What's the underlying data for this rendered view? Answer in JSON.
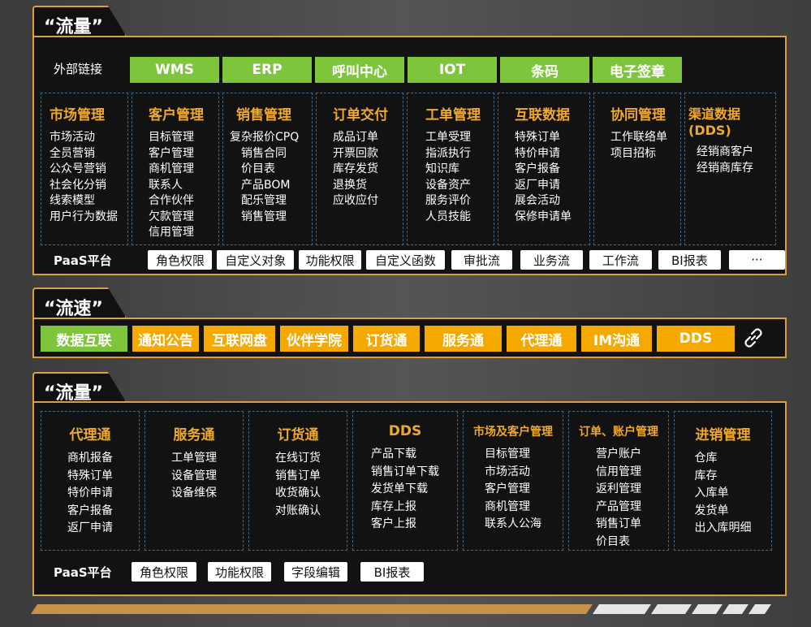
{
  "sections": [
    {
      "title": "“流量”",
      "external_label": "外部链接",
      "external_links": [
        "WMS",
        "ERP",
        "呼叫中心",
        "IOT",
        "条码",
        "电子签章"
      ],
      "modules": [
        {
          "title": "市场管理",
          "items": [
            "市场活动",
            "全员营销",
            "公众号营销",
            "社会化分销",
            "线索模型",
            "用户行为数据"
          ]
        },
        {
          "title": "客户管理",
          "items": [
            "目标管理",
            "客户管理",
            "商机管理",
            "联系人",
            "合作伙伴",
            "欠款管理",
            "信用管理"
          ]
        },
        {
          "title": "销售管理",
          "items": [
            "复杂报价CPQ",
            "销售合同",
            "价目表",
            "产品BOM",
            "配乐管理",
            "销售管理"
          ]
        },
        {
          "title": "订单交付",
          "items": [
            "成品订单",
            "开票回款",
            "库存发货",
            "退换货",
            "应收应付"
          ]
        },
        {
          "title": "工单管理",
          "items": [
            "工单受理",
            "指派执行",
            "知识库",
            "设备资产",
            "服务评价",
            "人员技能"
          ]
        },
        {
          "title": "互联数据",
          "items": [
            "特殊订单",
            "特价申请",
            "客户报备",
            "返厂申请",
            "展会活动",
            "保修申请单"
          ]
        },
        {
          "title": "协同管理",
          "items": [
            "工作联络单",
            "项目招标"
          ]
        },
        {
          "title": "渠道数据(DDS)",
          "items": [
            "经销商客户",
            "经销商库存"
          ]
        }
      ],
      "paas_label": "PaaS平台",
      "paas_items": [
        "角色权限",
        "自定义对象",
        "功能权限",
        "自定义函数",
        "审批流",
        "业务流",
        "工作流",
        "BI报表",
        "···"
      ]
    },
    {
      "title": "“流速”",
      "items": [
        {
          "label": "数据互联",
          "color": "#7ec53b"
        },
        {
          "label": "通知公告",
          "color": "#f5a800"
        },
        {
          "label": "互联网盘",
          "color": "#f5a800"
        },
        {
          "label": "伙伴学院",
          "color": "#f5a800"
        },
        {
          "label": "订货通",
          "color": "#f5a800"
        },
        {
          "label": "服务通",
          "color": "#f5a800"
        },
        {
          "label": "代理通",
          "color": "#f5a800"
        },
        {
          "label": "IM沟通",
          "color": "#f5a800"
        },
        {
          "label": "DDS",
          "color": "#f5a800"
        }
      ],
      "icon": "link-icon"
    },
    {
      "title": "“流量”",
      "modules": [
        {
          "title": "代理通",
          "items": [
            "商机报备",
            "特殊订单",
            "特价申请",
            "客户报备",
            "返厂申请"
          ]
        },
        {
          "title": "服务通",
          "items": [
            "工单管理",
            "设备管理",
            "设备维保"
          ]
        },
        {
          "title": "订货通",
          "items": [
            "在线订货",
            "销售订单",
            "收货确认",
            "对账确认"
          ]
        },
        {
          "title": "DDS",
          "items": [
            "产品下载",
            "销售订单下载",
            "发货单下载",
            "库存上报",
            "客户上报"
          ]
        },
        {
          "title": "市场及客户管理",
          "items": [
            "目标管理",
            "市场活动",
            "客户管理",
            "商机管理",
            "联系人公海"
          ]
        },
        {
          "title": "订单、账户管理",
          "items": [
            "营户账户",
            "信用管理",
            "返利管理",
            "产品管理",
            "销售订单",
            "价目表"
          ]
        },
        {
          "title": "进销管理",
          "items": [
            "仓库",
            "库存",
            "入库单",
            "发货单",
            "出入库明细"
          ]
        }
      ],
      "paas_label": "PaaS平台",
      "paas_items": [
        "角色权限",
        "功能权限",
        "字段编辑",
        "BI报表"
      ]
    }
  ],
  "colors": {
    "accent": "#d8a23a",
    "green": "#7ec53b",
    "orange": "#f5a800",
    "title_orange": "#f0a92b"
  }
}
